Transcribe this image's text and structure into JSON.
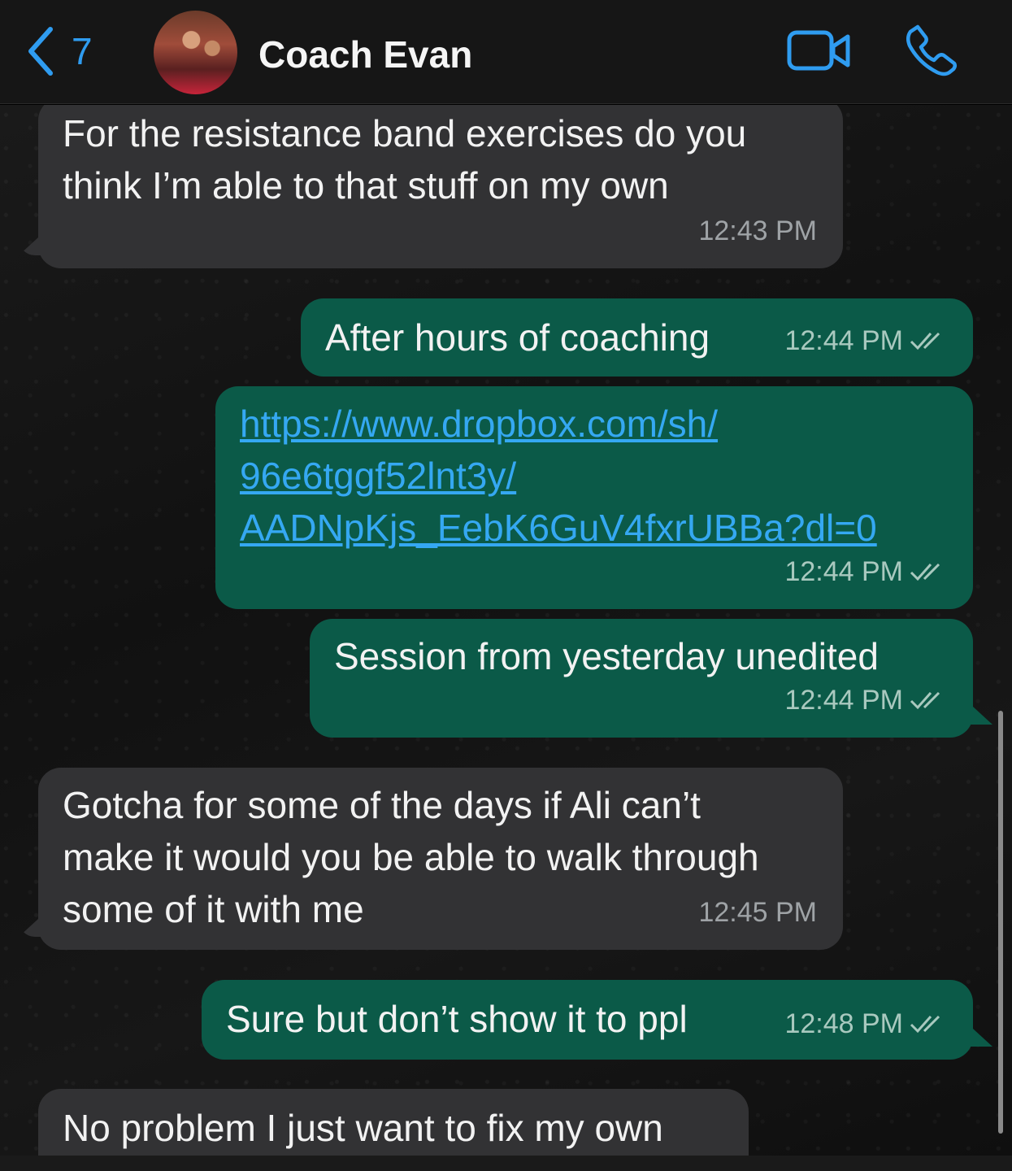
{
  "header": {
    "back_count": "7",
    "contact_name": "Coach Evan"
  },
  "colors": {
    "accent": "#2f9cf0",
    "incoming_bubble": "#323234",
    "outgoing_bubble": "#0b5a48",
    "link": "#35a8f2"
  },
  "messages": [
    {
      "direction": "incoming",
      "text": "For the resistance band exercises do you\nthink I’m able to that stuff on my own",
      "time": "12:43 PM"
    },
    {
      "direction": "outgoing",
      "text": "After hours of coaching",
      "time": "12:44 PM",
      "status": "read"
    },
    {
      "direction": "outgoing",
      "link": "https://www.dropbox.com/sh/\n96e6tggf52lnt3y/\nAADNpKjs_EebK6GuV4fxrUBBa?dl=0",
      "time": "12:44 PM",
      "status": "read"
    },
    {
      "direction": "outgoing",
      "text": "Session from yesterday unedited",
      "time": "12:44 PM",
      "status": "read"
    },
    {
      "direction": "incoming",
      "text": "Gotcha for some of the days if Ali can’t\nmake it would you be able to walk through\nsome of it with me",
      "time": "12:45 PM"
    },
    {
      "direction": "outgoing",
      "text": "Sure but don’t show it to ppl",
      "time": "12:48 PM",
      "status": "read"
    },
    {
      "direction": "incoming",
      "text": "No problem I just want to fix my own"
    }
  ]
}
